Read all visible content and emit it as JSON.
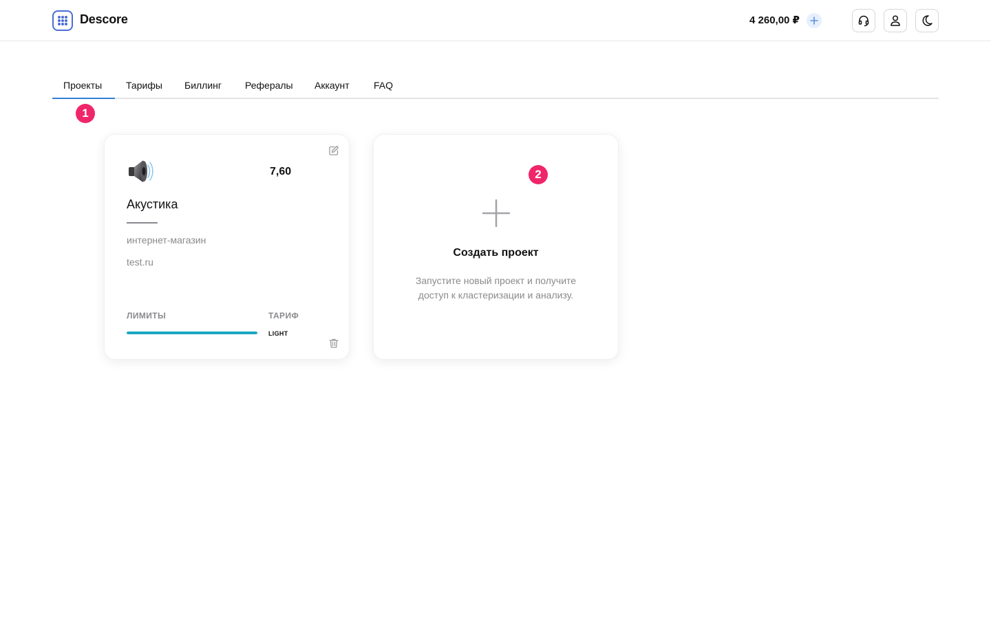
{
  "app": {
    "brand": "Descore",
    "brand_color": "#4a6cd4"
  },
  "header": {
    "balance": "4 260,00 ₽",
    "icons": [
      "plus-icon",
      "headset-icon",
      "user-icon",
      "moon-icon"
    ]
  },
  "tabs": [
    {
      "label": "Проекты",
      "active": true
    },
    {
      "label": "Тарифы",
      "active": false
    },
    {
      "label": "Биллинг",
      "active": false
    },
    {
      "label": "Рефералы",
      "active": false
    },
    {
      "label": "Аккаунт",
      "active": false
    },
    {
      "label": "FAQ",
      "active": false
    }
  ],
  "accent_color": "#2f7fd6",
  "steps": [
    "1",
    "2"
  ],
  "step_color": "#f0266a",
  "project": {
    "icon": "speaker-icon",
    "score": "7,60",
    "name": "Акустика",
    "type": "интернет-магазин",
    "domain": "test.ru",
    "limits_label": "ЛИМИТЫ",
    "limits_usage": 1.0,
    "limits_color": "#1aa7c2",
    "tariff_label": "ТАРИФ",
    "tariff_value": "LIGHT"
  },
  "create_card": {
    "title": "Создать проект",
    "description": "Запустите новый проект и получите доступ к кластеризации и анализу."
  }
}
